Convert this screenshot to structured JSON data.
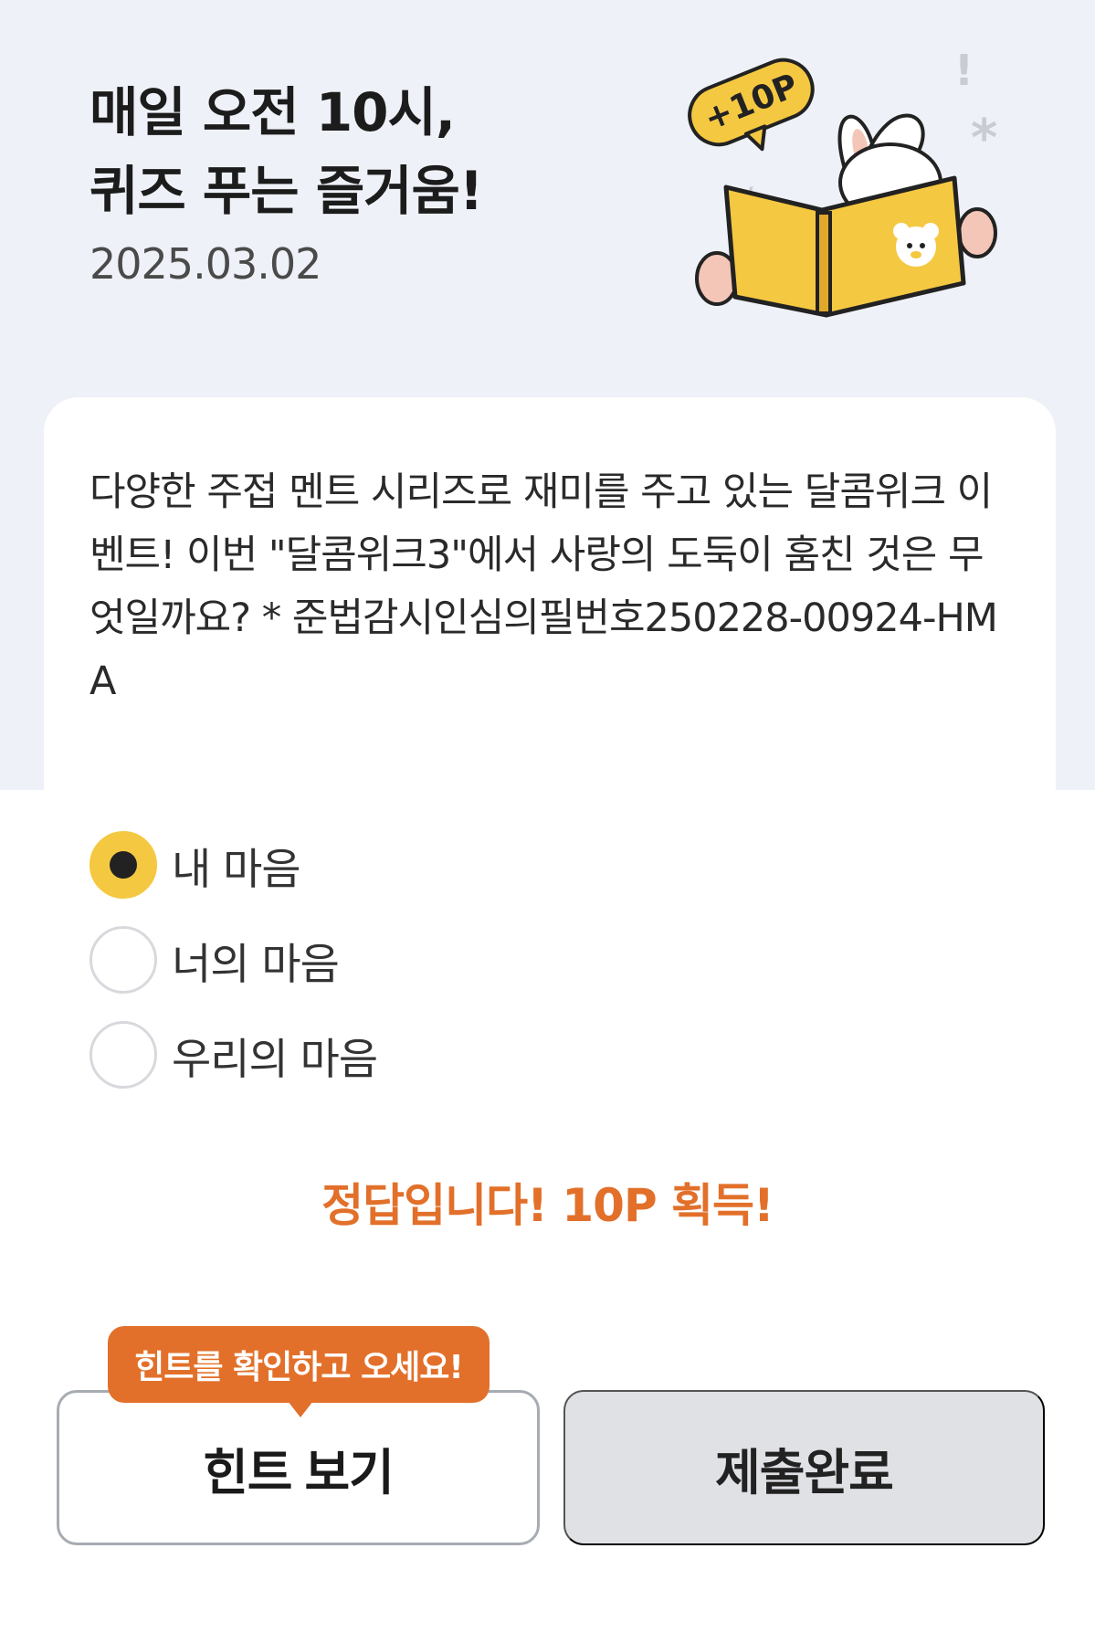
{
  "header": {
    "title_line1": "매일 오전 10시,",
    "title_line2": "퀴즈 푸는 즐거움!",
    "date": "2025.03.02"
  },
  "illustration": {
    "badge_text": "+10P",
    "icon": "reading-bunny-illustration"
  },
  "question": {
    "text": "다양한 주접 멘트 시리즈로 재미를 주고 있는 달콤위크 이벤트! 이번 \"달콤위크3\"에서 사랑의 도둑이 훔친 것은 무엇일까요? * 준법감시인심의필번호250228-00924-HMA"
  },
  "options": [
    {
      "label": "내 마음",
      "selected": true
    },
    {
      "label": "너의 마음",
      "selected": false
    },
    {
      "label": "우리의 마음",
      "selected": false
    }
  ],
  "result": {
    "text": "정답입니다! 10P 획득!"
  },
  "buttons": {
    "hint_tooltip": "힌트를 확인하고 오세요!",
    "hint_label": "힌트 보기",
    "submit_label": "제출완료"
  },
  "colors": {
    "accent_orange": "#e2702a",
    "selected_yellow": "#f5c842",
    "background_band": "#eef1f7",
    "submit_bg": "#dfe1e5"
  }
}
